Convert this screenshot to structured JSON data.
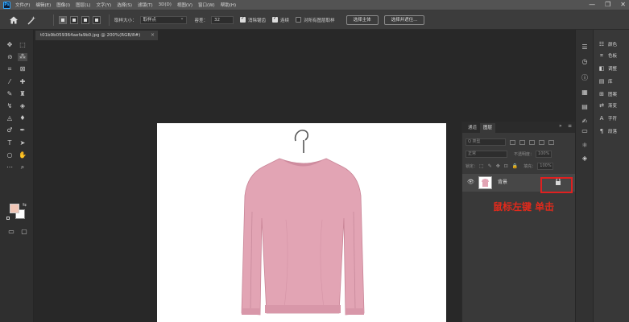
{
  "menubar": {
    "logo": "Ps",
    "items": [
      "文件(F)",
      "编辑(E)",
      "图像(I)",
      "图层(L)",
      "文字(Y)",
      "选择(S)",
      "滤镜(T)",
      "3D(D)",
      "视图(V)",
      "窗口(W)",
      "帮助(H)"
    ],
    "win_min": "—",
    "win_max": "❐",
    "win_close": "✕"
  },
  "options": {
    "sample_size_label": "取样大小：",
    "sample_size_value": "取样点",
    "tolerance_label": "容差：",
    "tolerance_value": "32",
    "antialias_label": "消除锯齿",
    "contiguous_label": "连续",
    "sample_all_label": "对所有图层取样",
    "select_subject_label": "选择主体",
    "select_refine_label": "选择并遮住..."
  },
  "document_tab": {
    "title": "t01b9b059364aefa9b0.jpg @ 200%(RGB/8#)",
    "close": "×"
  },
  "layers_panel": {
    "tab_channels": "通道",
    "tab_layers": "图层",
    "collapse": "»",
    "menu": "≡",
    "search_placeholder": "Q 类型",
    "blend_mode": "正常",
    "opacity_label": "不透明度：",
    "opacity_value": "100%",
    "lock_label": "锁定：",
    "fill_label": "填充：",
    "fill_value": "100%",
    "layer_name": "背景",
    "lock_icon": "🔒",
    "eye_icon": "👁"
  },
  "right_panel": {
    "items": [
      {
        "icon": "☷",
        "label": "颜色"
      },
      {
        "icon": "⌗",
        "label": "色板"
      },
      {
        "icon": "◧",
        "label": "调整"
      },
      {
        "icon": "▤",
        "label": "库"
      },
      {
        "icon": "⊞",
        "label": "图案"
      },
      {
        "icon": "⇄",
        "label": "渐变"
      },
      {
        "icon": "A",
        "label": "字符"
      },
      {
        "icon": "¶",
        "label": "段落"
      }
    ]
  },
  "annotation": {
    "text": "鼠标左键 单击",
    "color": "#e02a1c"
  },
  "colors": {
    "foreground": "#f1c6b6",
    "background": "#ffffff",
    "sweater": "#e2a4b4"
  }
}
